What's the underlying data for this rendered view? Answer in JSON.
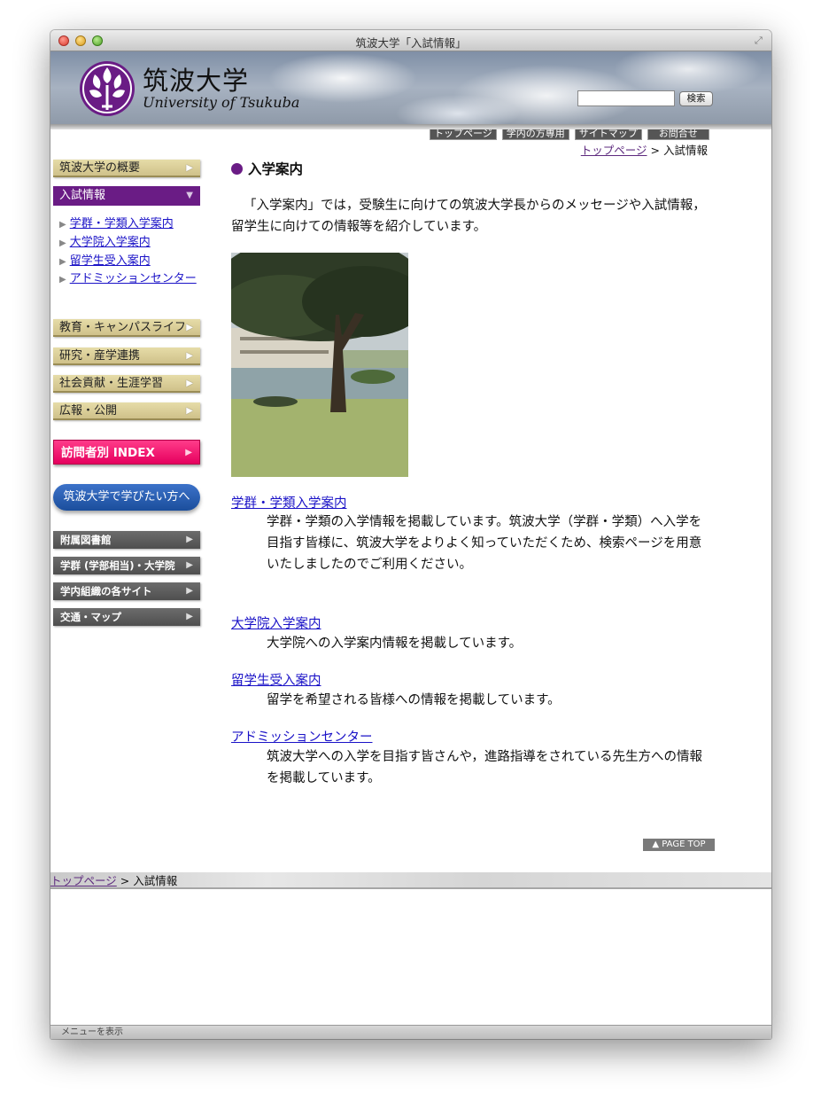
{
  "window": {
    "title": "筑波大学「入試情報」"
  },
  "header": {
    "logo_jp": "筑波大学",
    "logo_en": "University of Tsukuba",
    "search_value": "",
    "search_button": "検索",
    "nav": [
      "トップページ",
      "学内の方専用",
      "サイトマップ",
      "お問合せ"
    ]
  },
  "breadcrumb": {
    "home": "トップページ",
    "sep": ">",
    "current": "入試情報"
  },
  "sidebar": {
    "about": "筑波大学の概要",
    "admission": "入試情報",
    "sub_items": [
      "学群・学類入学案内",
      "大学院入学案内",
      "留学生受入案内",
      "アドミッションセンター"
    ],
    "sections": [
      "教育・キャンパスライフ",
      "研究・産学連携",
      "社会貢献・生涯学習",
      "広報・公開"
    ],
    "visitor_index": "訪問者別 INDEX",
    "study_button": "筑波大学で学びたい方へ",
    "gray_items": [
      "附属図書館",
      "学群 (学部相当)・大学院",
      "学内組織の各サイト",
      "交通・マップ"
    ]
  },
  "main": {
    "title": "入学案内",
    "intro": "「入学案内」では，受験生に向けての筑波大学長からのメッセージや入試情報，留学生に向けての情報等を紹介しています。",
    "entries": [
      {
        "link": "学群・学類入学案内",
        "desc": "学群・学類の入学情報を掲載しています。筑波大学（学群・学類）へ入学を目指す皆様に、筑波大学をよりよく知っていただくため、検索ページを用意いたしましたのでご利用ください。"
      },
      {
        "link": "大学院入学案内",
        "desc": "大学院への入学案内情報を掲載しています。"
      },
      {
        "link": "留学生受入案内",
        "desc": "留学を希望される皆様への情報を掲載しています。"
      },
      {
        "link": "アドミッションセンター",
        "desc": "筑波大学への入学を目指す皆さんや，進路指導をされている先生方への情報を掲載しています。"
      }
    ],
    "page_top": "▲ PAGE TOP"
  },
  "footer": {
    "home": "トップページ",
    "sep": ">",
    "current": "入試情報"
  },
  "status": {
    "text": "メニューを表示"
  },
  "colors": {
    "accent_purple": "#6a1c85",
    "link": "#1a12c7",
    "pink": "#e6005e"
  }
}
